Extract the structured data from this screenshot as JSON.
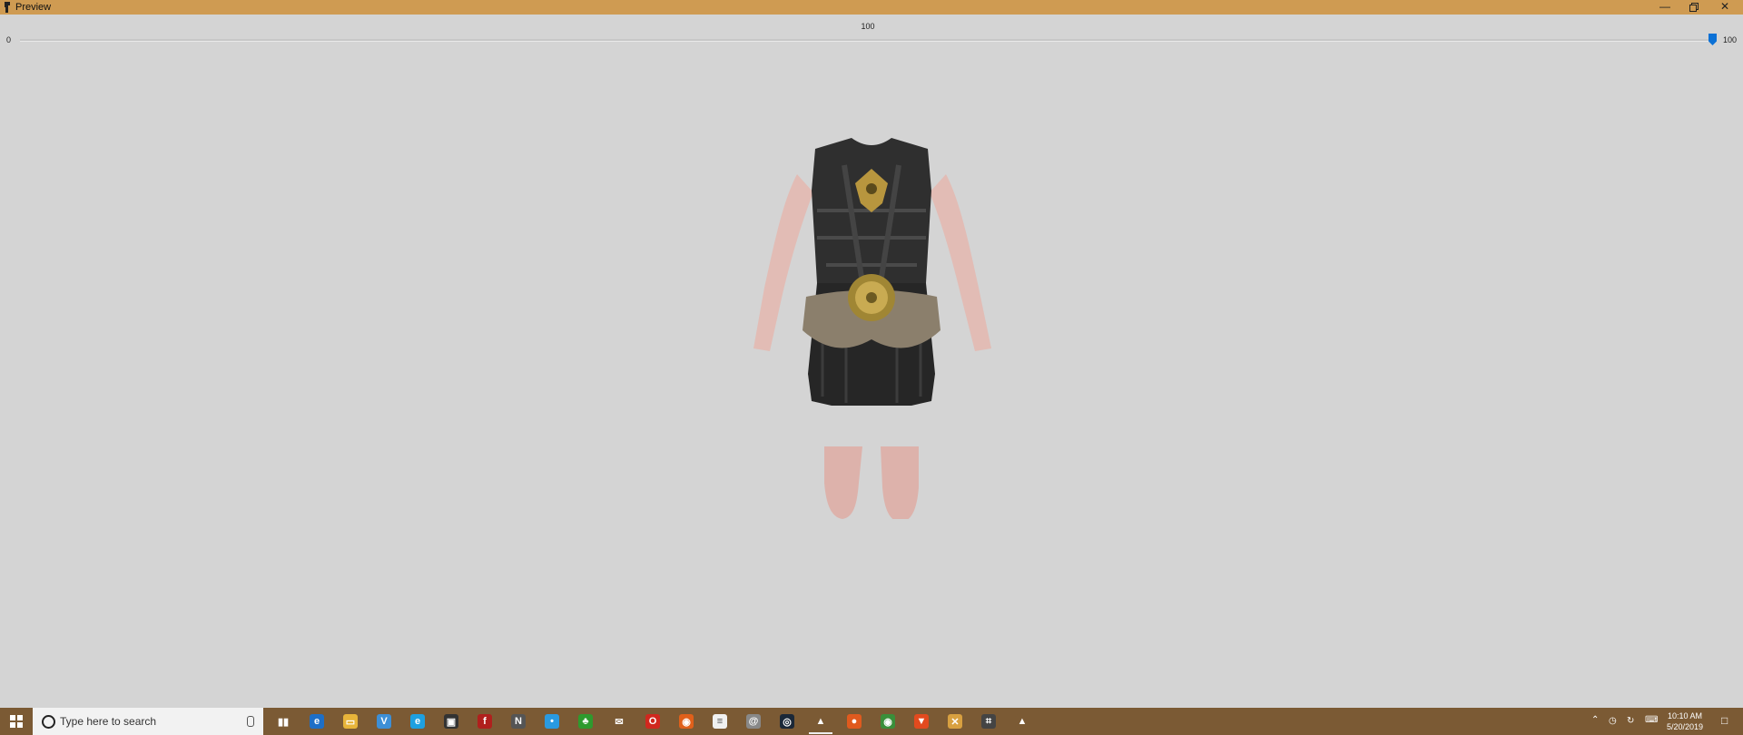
{
  "window": {
    "title": "Preview",
    "icon": "armor-app-icon",
    "controls": [
      "minimize-icon",
      "restore-icon",
      "close-icon"
    ]
  },
  "slider": {
    "value_label": "100",
    "min_label": "0",
    "max_label": "100",
    "value": 100,
    "min": 0,
    "max": 100,
    "thumb_color": "#0b71d6"
  },
  "viewport": {
    "content": "armored-body-model",
    "background": "#d4d4d4"
  },
  "taskbar": {
    "color": "#7b5a34",
    "search_placeholder": "Type here to search",
    "pinned": [
      {
        "name": "task-view-icon"
      },
      {
        "name": "edge-icon"
      },
      {
        "name": "file-explorer-icon"
      },
      {
        "name": "visual-studio-icon"
      },
      {
        "name": "internet-explorer-icon"
      },
      {
        "name": "photo-app-icon"
      },
      {
        "name": "flash-icon"
      },
      {
        "name": "n-app-icon"
      },
      {
        "name": "chat-icon"
      },
      {
        "name": "clover-icon"
      },
      {
        "name": "mail-icon"
      },
      {
        "name": "opera-icon"
      },
      {
        "name": "firefox-icon"
      },
      {
        "name": "notepad-icon"
      },
      {
        "name": "spiral-icon"
      },
      {
        "name": "steam-icon"
      },
      {
        "name": "preview-app-icon",
        "active": true
      },
      {
        "name": "orange-app-icon"
      },
      {
        "name": "chrome-icon"
      },
      {
        "name": "brave-icon"
      },
      {
        "name": "x-app-icon"
      },
      {
        "name": "controller-icon"
      },
      {
        "name": "armor-app-icon"
      }
    ],
    "clock_time": "10:10 AM",
    "clock_date": "5/20/2019"
  }
}
